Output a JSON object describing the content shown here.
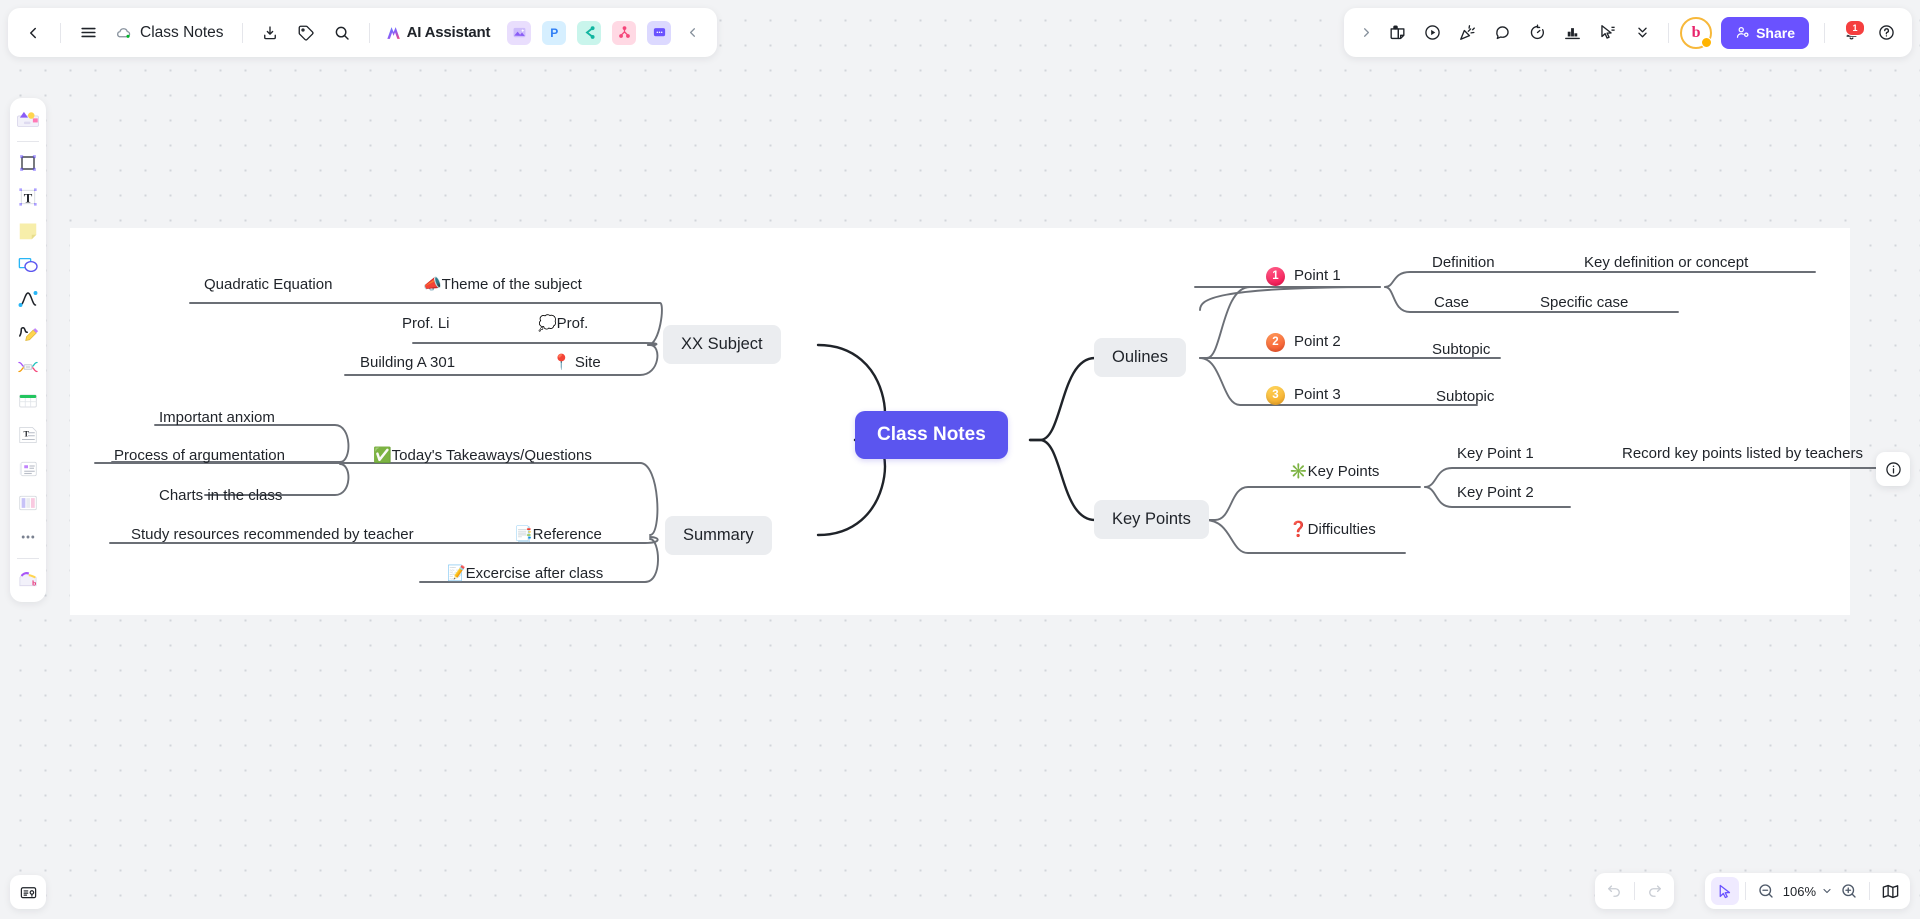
{
  "app": {
    "doc_title": "Class Notes",
    "ai_assistant_label": "AI Assistant",
    "share_label": "Share",
    "notification_count": "1",
    "zoom_level": "106%"
  },
  "toolbar_left": {
    "back_icon": "back-chevron-icon",
    "menu_icon": "hamburger-menu-icon",
    "cloud_icon": "cloud-saved-icon",
    "download_icon": "download-icon",
    "tag_icon": "tag-icon",
    "search_icon": "search-icon",
    "collapse_icon": "collapse-chevron-icon",
    "app_chips": [
      {
        "name": "image-app-chip",
        "glyph": "⛰",
        "bg": "#e9defd",
        "fg": "#8a5cf6"
      },
      {
        "name": "presentation-app-chip",
        "glyph": "P",
        "bg": "#d6efff",
        "fg": "#2f7ef5"
      },
      {
        "name": "flow-app-chip",
        "glyph": "◀",
        "bg": "#c9f5ec",
        "fg": "#12b5a0"
      },
      {
        "name": "mindmap-app-chip",
        "glyph": "∴",
        "bg": "#ffd9e4",
        "fg": "#f5467a"
      },
      {
        "name": "comment-app-chip",
        "glyph": "⋯",
        "bg": "#dcd9ff",
        "fg": "#6a52ff"
      }
    ]
  },
  "toolbar_right": {
    "items": [
      {
        "name": "expand-chevron-icon",
        "label": ""
      },
      {
        "name": "sticker-note-icon",
        "label": ""
      },
      {
        "name": "play-circle-icon",
        "label": ""
      },
      {
        "name": "party-popper-icon",
        "label": ""
      },
      {
        "name": "comment-bubble-icon",
        "label": ""
      },
      {
        "name": "timer-icon",
        "label": ""
      },
      {
        "name": "vote-chart-icon",
        "label": ""
      },
      {
        "name": "cursor-pointer-icon",
        "label": ""
      },
      {
        "name": "chevrons-down-icon",
        "label": ""
      }
    ],
    "avatar_label": "b",
    "bell_icon": "notification-bell-icon",
    "help_icon": "help-question-icon"
  },
  "left_rail": {
    "items": [
      {
        "name": "sticker-library-tool",
        "glyph": "stickers"
      },
      {
        "name": "frame-tool",
        "glyph": "frame"
      },
      {
        "name": "text-tool",
        "glyph": "text"
      },
      {
        "name": "sticky-note-tool",
        "glyph": "note"
      },
      {
        "name": "shape-tool",
        "glyph": "shape"
      },
      {
        "name": "connector-line-tool",
        "glyph": "curve"
      },
      {
        "name": "pen-tool",
        "glyph": "pen"
      },
      {
        "name": "mindmap-tool",
        "glyph": "mindmap"
      },
      {
        "name": "table-tool",
        "glyph": "table"
      },
      {
        "name": "document-tool",
        "glyph": "doc"
      },
      {
        "name": "card-tool",
        "glyph": "cards"
      },
      {
        "name": "kanban-tool",
        "glyph": "kanban"
      },
      {
        "name": "more-tools",
        "glyph": "more"
      },
      {
        "name": "template-library-tool",
        "glyph": "templates"
      }
    ],
    "bottom_icon": "presentation-mode-icon"
  },
  "bottom_bar": {
    "undo_icon": "undo-icon",
    "redo_icon": "redo-icon",
    "cursor_icon": "cursor-select-icon",
    "zoom_out_icon": "zoom-out-icon",
    "zoom_in_icon": "zoom-in-icon",
    "zoom_dropdown_icon": "chevron-down-icon",
    "minimap_icon": "minimap-icon"
  },
  "info_panel": {
    "icon": "info-circle-icon"
  },
  "mindmap": {
    "root": {
      "label": "Class Notes",
      "color": "#5b55ef"
    },
    "branches": [
      {
        "name": "xx-subject",
        "label": "XX Subject",
        "side": "left",
        "children": [
          {
            "label": "📣Theme of the subject",
            "grandchildren": [
              {
                "label": "Quadratic Equation"
              }
            ]
          },
          {
            "label": "💭Prof.",
            "grandchildren": [
              {
                "label": "Prof. Li"
              }
            ]
          },
          {
            "label": "📍 Site",
            "grandchildren": [
              {
                "label": "Building A 301"
              }
            ]
          }
        ]
      },
      {
        "name": "summary",
        "label": "Summary",
        "side": "left",
        "children": [
          {
            "label": "✅Today's Takeaways/Questions",
            "grandchildren": [
              {
                "label": "Important anxiom"
              },
              {
                "label": "Process of argumentation"
              },
              {
                "label": "Charts in the class"
              }
            ]
          },
          {
            "label": "📑Reference",
            "grandchildren": [
              {
                "label": "Study resources recommended by teacher"
              }
            ]
          },
          {
            "label": "📝Excercise after class",
            "grandchildren": []
          }
        ]
      },
      {
        "name": "oulines",
        "label": "Oulines",
        "side": "right",
        "children": [
          {
            "label": "Point 1",
            "badge": "1",
            "badge_color": "#f5275f",
            "grandchildren": [
              {
                "label": "Definition",
                "great": "Key definition or concept"
              },
              {
                "label": "Case",
                "great": "Specific case"
              }
            ]
          },
          {
            "label": "Point 2",
            "badge": "2",
            "badge_color": "#fb6a3c",
            "grandchildren": [
              {
                "label": "Subtopic"
              }
            ]
          },
          {
            "label": "Point 3",
            "badge": "3",
            "badge_color": "#fbbf24",
            "grandchildren": [
              {
                "label": "Subtopic"
              }
            ]
          }
        ]
      },
      {
        "name": "key-points",
        "label": "Key Points",
        "side": "right",
        "children": [
          {
            "label": "✳️Key Points",
            "grandchildren": [
              {
                "label": "Key Point 1",
                "great": "Record key points listed by teachers"
              },
              {
                "label": "Key Point 2"
              }
            ]
          },
          {
            "label": "❓Difficulties",
            "grandchildren": []
          }
        ]
      }
    ]
  }
}
